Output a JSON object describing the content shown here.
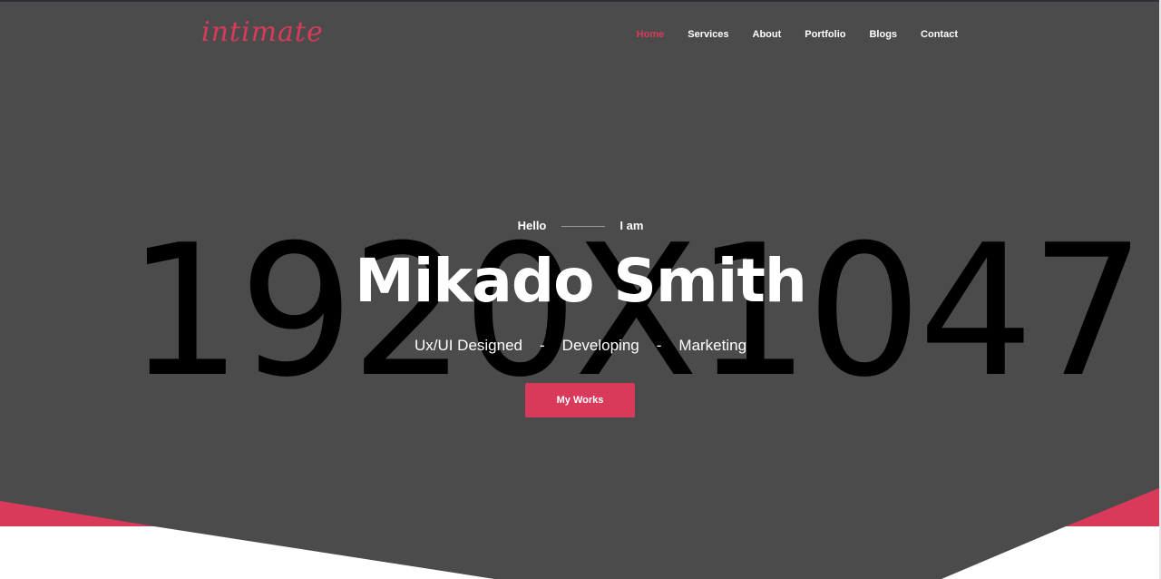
{
  "brand": {
    "logo": "intimate"
  },
  "nav": {
    "items": [
      {
        "label": "Home",
        "active": true
      },
      {
        "label": "Services",
        "active": false
      },
      {
        "label": "About",
        "active": false
      },
      {
        "label": "Portfolio",
        "active": false
      },
      {
        "label": "Blogs",
        "active": false
      },
      {
        "label": "Contact",
        "active": false
      }
    ]
  },
  "hero": {
    "background_placeholder": "1920X1047",
    "greeting_left": "Hello",
    "greeting_right": "I am",
    "name": "Mikado Smith",
    "roles": [
      "Ux/UI Designed",
      "Developing",
      "Marketing"
    ],
    "role_separator": "-",
    "cta_label": "My Works"
  },
  "colors": {
    "accent": "#d93a5a",
    "hero_background": "#4b4b4c",
    "text": "#ffffff"
  }
}
